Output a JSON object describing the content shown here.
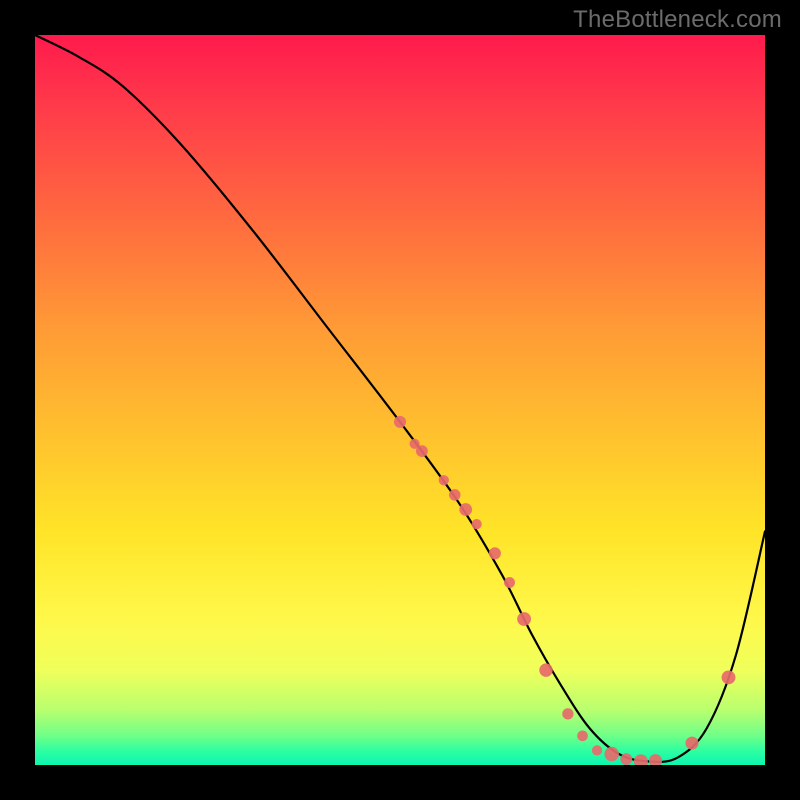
{
  "watermark": "TheBottleneck.com",
  "chart_data": {
    "type": "line",
    "title": "",
    "xlabel": "",
    "ylabel": "",
    "xlim": [
      0,
      100
    ],
    "ylim": [
      0,
      100
    ],
    "background_gradient": [
      {
        "stop": 0,
        "color": "#ff1a4d"
      },
      {
        "stop": 25,
        "color": "#ff6a3f"
      },
      {
        "stop": 55,
        "color": "#ffc22e"
      },
      {
        "stop": 80,
        "color": "#fff84a"
      },
      {
        "stop": 96,
        "color": "#6fff88"
      },
      {
        "stop": 100,
        "color": "#0cf5b1"
      }
    ],
    "series": [
      {
        "name": "bottleneck-curve",
        "stroke": "#000000",
        "x": [
          0,
          6,
          12,
          20,
          30,
          40,
          50,
          58,
          64,
          68,
          72,
          76,
          80,
          84,
          88,
          92,
          96,
          100
        ],
        "values": [
          100,
          97,
          93,
          85,
          73,
          60,
          47,
          36,
          26,
          18,
          11,
          5,
          1.5,
          0.5,
          1,
          5,
          15,
          32
        ]
      }
    ],
    "markers": {
      "name": "highlighted-points",
      "color": "#e76a6a",
      "x": [
        50,
        52,
        53,
        56,
        57.5,
        59,
        60.5,
        63,
        65,
        67,
        70,
        73,
        75,
        77,
        79,
        81,
        83,
        85,
        90,
        95
      ],
      "values": [
        47,
        44,
        43,
        39,
        37,
        35,
        33,
        29,
        25,
        20,
        13,
        7,
        4,
        2,
        1.5,
        0.8,
        0.5,
        0.6,
        3,
        12
      ]
    }
  }
}
